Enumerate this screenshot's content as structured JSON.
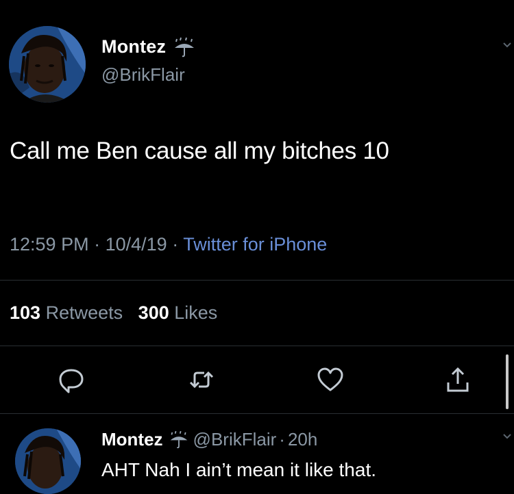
{
  "tweet": {
    "display_name": "Montez",
    "handle": "@BrikFlair",
    "badge_icon": "umbrella-rain-emoji",
    "text": "Call me Ben cause all my bitches 10",
    "time": "12:59 PM",
    "date": "10/4/19",
    "separator": "·",
    "source": "Twitter for iPhone",
    "retweet_count": "103",
    "retweet_label": "Retweets",
    "like_count": "300",
    "like_label": "Likes"
  },
  "actions": [
    {
      "icon": "reply-icon"
    },
    {
      "icon": "retweet-icon"
    },
    {
      "icon": "like-icon"
    },
    {
      "icon": "share-icon"
    }
  ],
  "reply": {
    "display_name": "Montez",
    "handle": "@BrikFlair",
    "separator": "·",
    "age": "20h",
    "text": "AHT Nah I ain’t mean it like that."
  },
  "colors": {
    "background": "#000000",
    "text": "#ffffff",
    "muted": "#8b98a5",
    "link": "#6a8fd8",
    "divider": "#2a2f33"
  }
}
